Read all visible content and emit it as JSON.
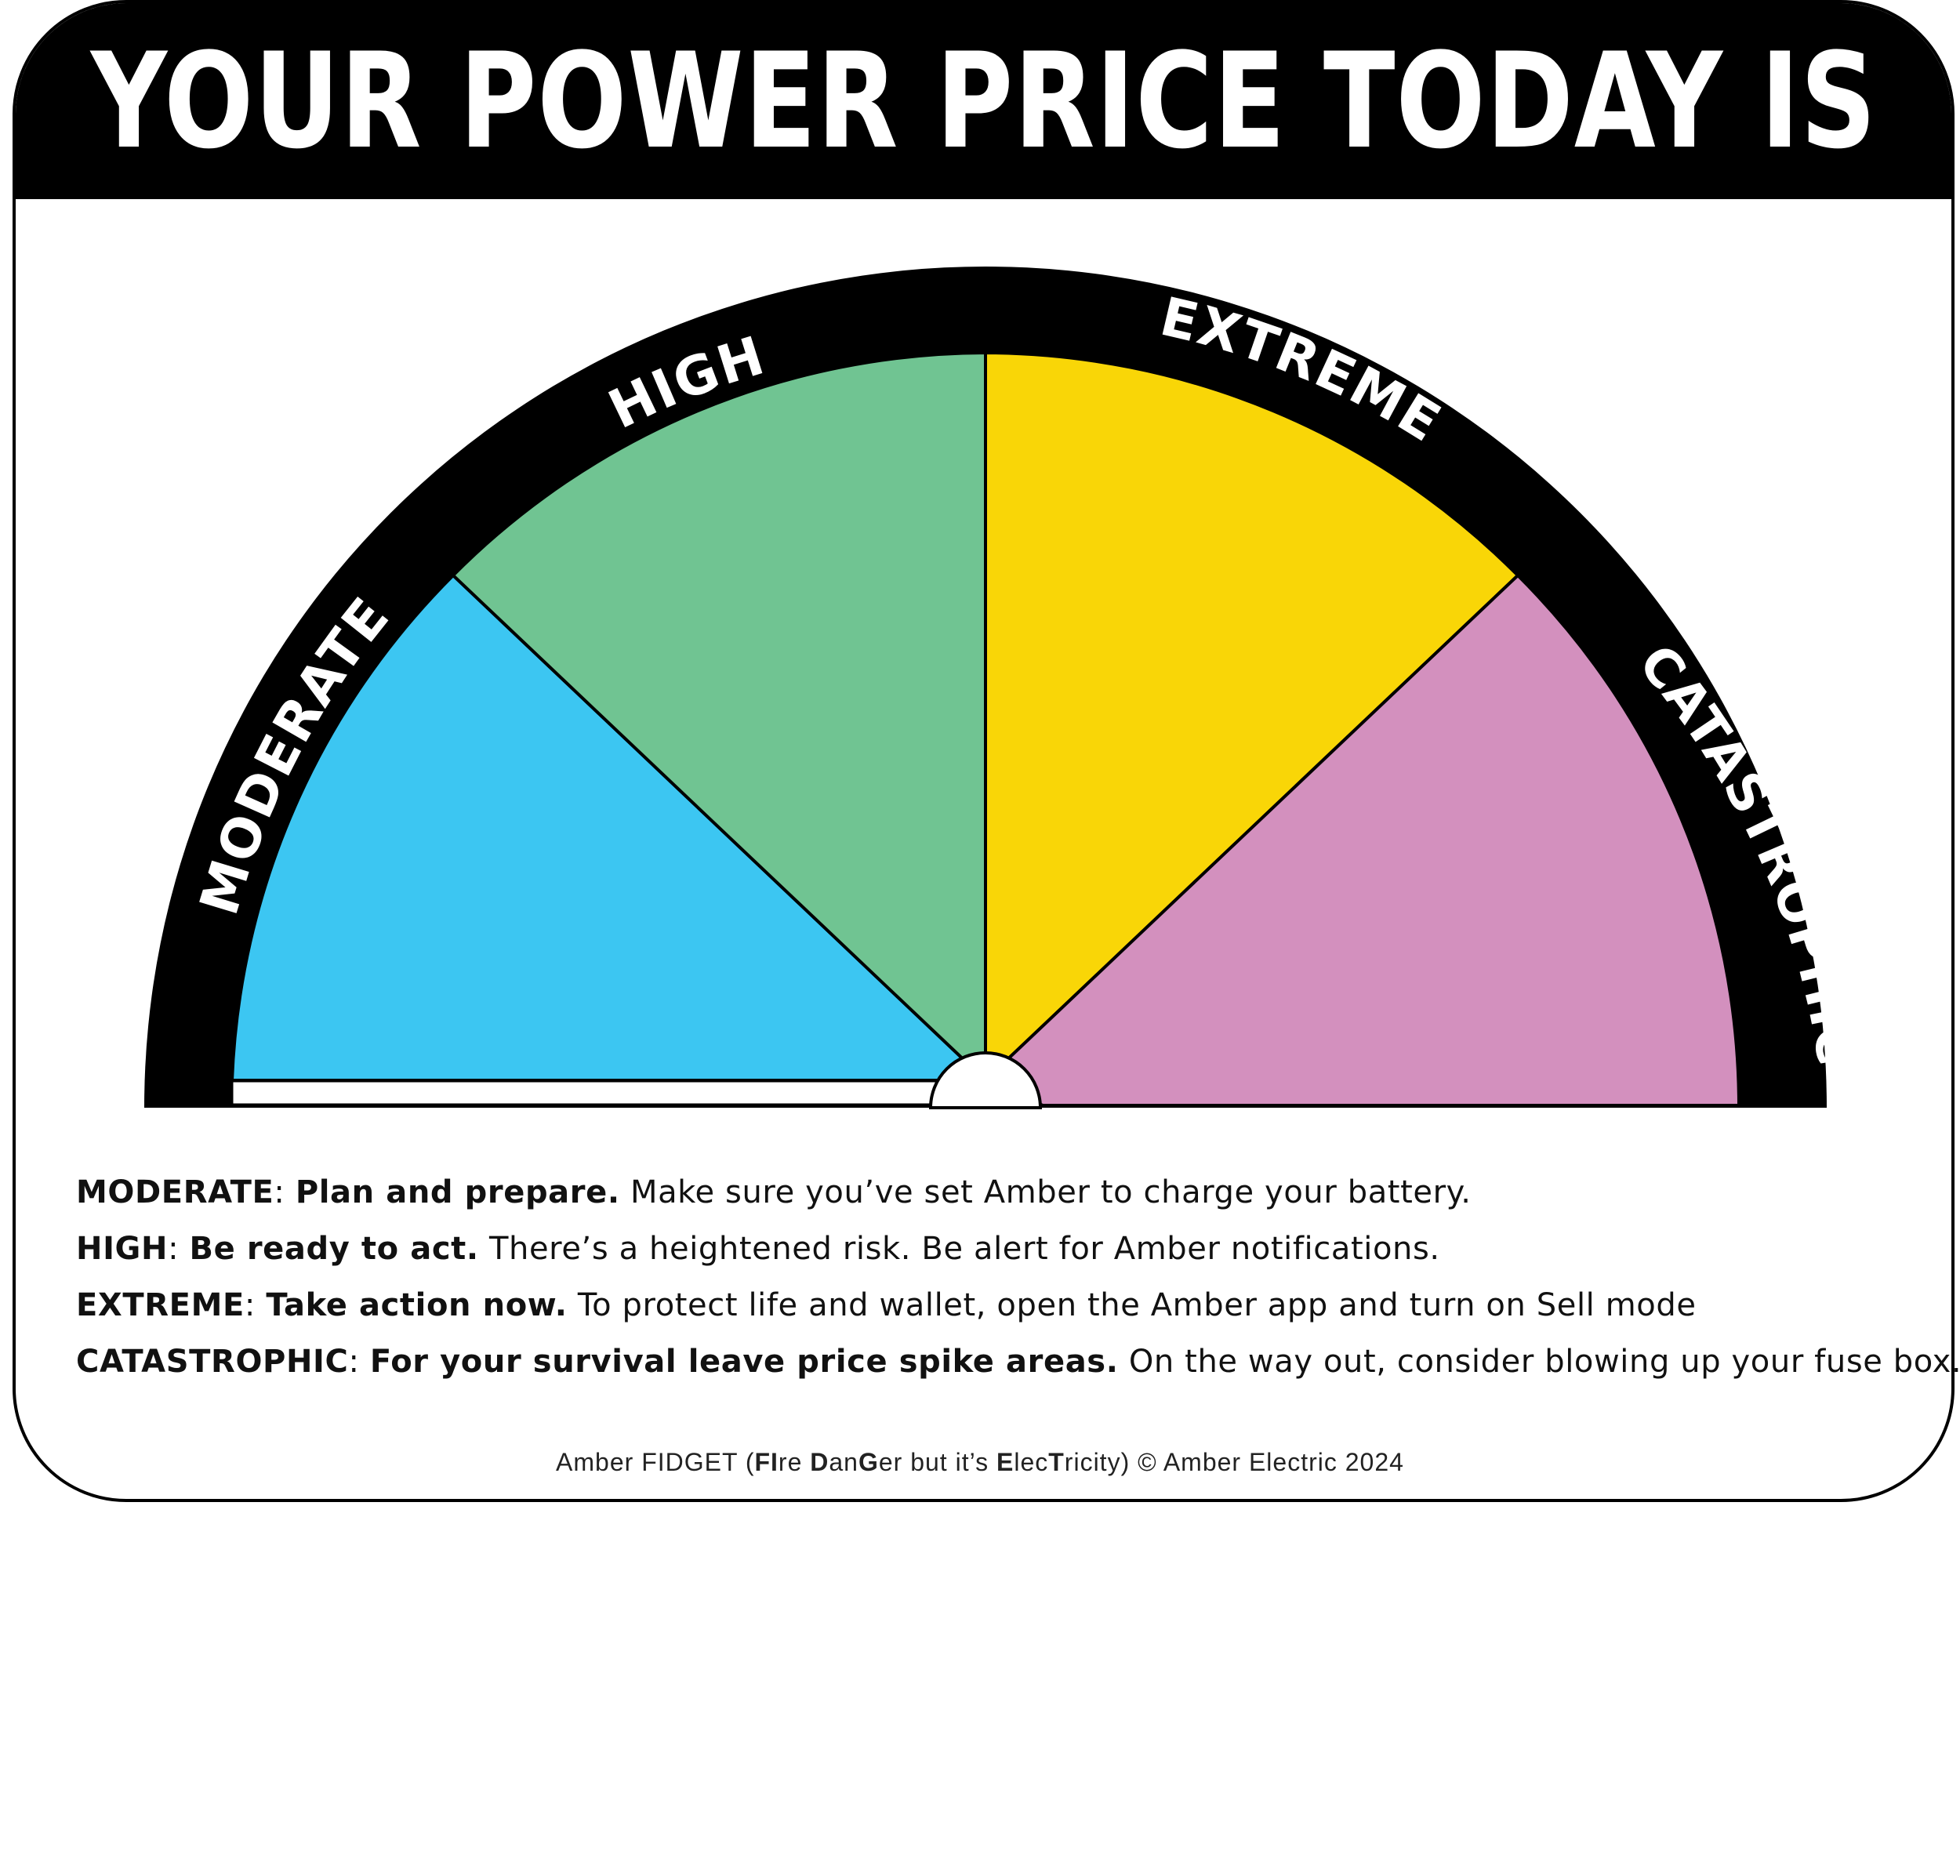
{
  "header": {
    "title": "YOUR POWER PRICE TODAY IS"
  },
  "gauge": {
    "segments": [
      {
        "key": "moderate",
        "label": "MODERATE",
        "color": "#3CC6F2"
      },
      {
        "key": "high",
        "label": "HIGH",
        "color": "#70C492"
      },
      {
        "key": "extreme",
        "label": "EXTREME",
        "color": "#F9D607"
      },
      {
        "key": "catastrophic",
        "label": "CATASTROPHIC",
        "color": "#D390BE"
      }
    ],
    "ring_color": "#000000"
  },
  "legend": [
    {
      "level": "MODERATE",
      "sep": ": ",
      "action": "Plan and prepare.",
      "detail": " Make sure you’ve set Amber to charge your battery."
    },
    {
      "level": "HIGH",
      "sep": ": ",
      "action": "Be ready to act.",
      "detail": " There’s a heightened risk. Be alert for Amber notifications."
    },
    {
      "level": "EXTREME",
      "sep": ": ",
      "action": "Take action now.",
      "detail": " To protect life and wallet, open the Amber app and turn on Sell mode"
    },
    {
      "level": "CATASTROPHIC",
      "sep": ": ",
      "action": "For your survival leave price spike areas.",
      "detail": " On the way out, consider blowing up your fuse box."
    }
  ],
  "footer": {
    "p1": "Amber FIDGET (",
    "b1": "FI",
    "p2": "re ",
    "b2": "D",
    "p3": "an",
    "b3": "G",
    "p4": "er but it’s ",
    "b4": "E",
    "p5": "lec",
    "b5": "T",
    "p6": "ricity) © Amber Electric 2024"
  }
}
